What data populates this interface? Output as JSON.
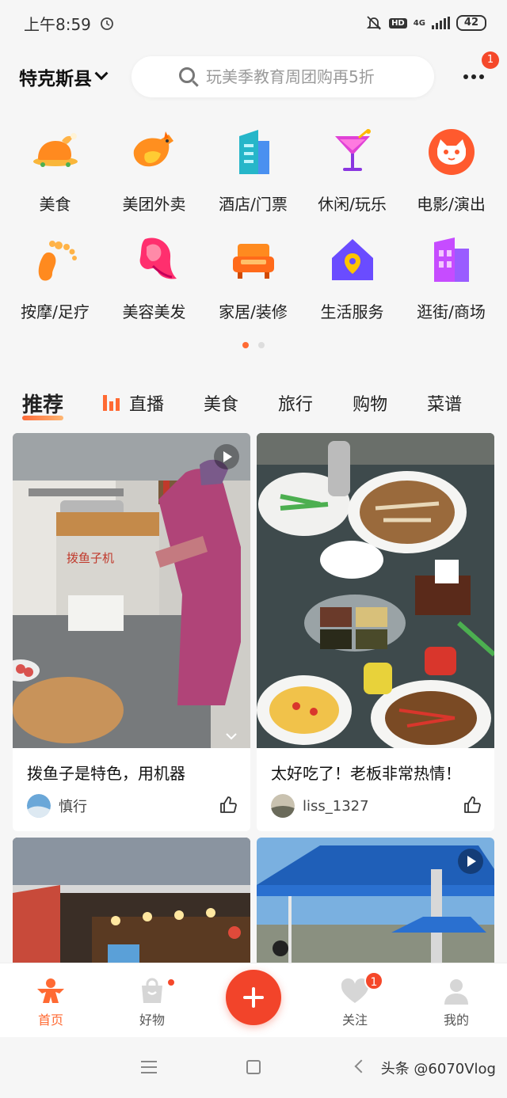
{
  "status_bar": {
    "time": "上午8:59",
    "hd": "HD",
    "network": "4G",
    "battery": "42"
  },
  "header": {
    "location": "特克斯县",
    "search_placeholder": "玩美季教育周团购再5折",
    "more_badge": "1"
  },
  "categories": [
    {
      "label": "美食",
      "icon": "roast-chicken-icon"
    },
    {
      "label": "美团外卖",
      "icon": "kangaroo-icon"
    },
    {
      "label": "酒店/门票",
      "icon": "hotel-building-icon"
    },
    {
      "label": "休闲/玩乐",
      "icon": "cocktail-icon"
    },
    {
      "label": "电影/演出",
      "icon": "cat-face-icon"
    },
    {
      "label": "按摩/足疗",
      "icon": "foot-icon"
    },
    {
      "label": "美容美发",
      "icon": "hair-profile-icon"
    },
    {
      "label": "家居/装修",
      "icon": "sofa-icon"
    },
    {
      "label": "生活服务",
      "icon": "house-pin-icon"
    },
    {
      "label": "逛街/商场",
      "icon": "mall-building-icon"
    }
  ],
  "tabs": [
    {
      "label": "推荐",
      "active": true
    },
    {
      "label": "直播",
      "active": false
    },
    {
      "label": "美食",
      "active": false
    },
    {
      "label": "旅行",
      "active": false
    },
    {
      "label": "购物",
      "active": false
    },
    {
      "label": "菜谱",
      "active": false
    }
  ],
  "feed": [
    {
      "title": "拨鱼子是特色，用机器",
      "user": "慎行",
      "photo_sign": "拨鱼子机",
      "is_video": true
    },
    {
      "title": "太好吃了！老板非常热情！",
      "user": "liss_1327",
      "is_video": false
    },
    {
      "title": "",
      "user": "",
      "is_video": false
    },
    {
      "title": "",
      "user": "",
      "is_video": true
    }
  ],
  "bottom_nav": [
    {
      "label": "首页",
      "icon": "home-person-icon",
      "active": true
    },
    {
      "label": "好物",
      "icon": "shopping-bag-icon",
      "active": false
    },
    {
      "label": "",
      "icon": "plus-icon",
      "active": false
    },
    {
      "label": "关注",
      "icon": "heart-icon",
      "badge": "1",
      "active": false
    },
    {
      "label": "我的",
      "icon": "profile-icon",
      "active": false
    }
  ],
  "watermark": "头条 @6070Vlog",
  "colors": {
    "accent": "#ff6a33",
    "badge": "#f5482a",
    "plus": "#f2442a"
  }
}
